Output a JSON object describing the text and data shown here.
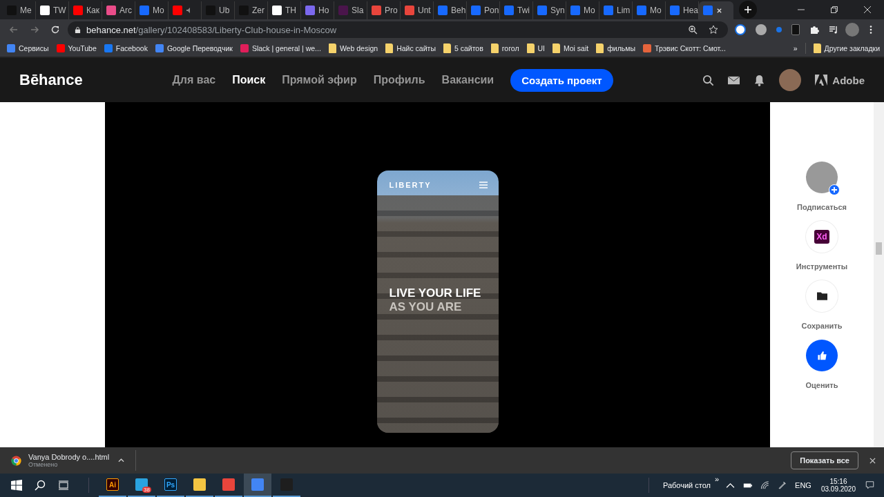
{
  "tabs": [
    {
      "title": "Me",
      "kind": "dark",
      "selected": false
    },
    {
      "title": "TW",
      "kind": "w",
      "selected": false
    },
    {
      "title": "Как",
      "kind": "yt",
      "selected": false
    },
    {
      "title": "Arc",
      "kind": "pink",
      "selected": false
    },
    {
      "title": "Mo",
      "kind": "be",
      "selected": false
    },
    {
      "kind": "yt",
      "muted": true,
      "selected": false
    },
    {
      "title": "Ub",
      "kind": "dark",
      "selected": false
    },
    {
      "title": "Zer",
      "kind": "dark",
      "selected": false
    },
    {
      "title": "TH",
      "kind": "m",
      "selected": false
    },
    {
      "title": "Ho",
      "kind": "violet",
      "selected": false
    },
    {
      "title": "Sla",
      "kind": "slack",
      "selected": false
    },
    {
      "title": "Pro",
      "kind": "red",
      "selected": false
    },
    {
      "title": "Unt",
      "kind": "red",
      "selected": false
    },
    {
      "title": "Beh",
      "kind": "be",
      "selected": false
    },
    {
      "title": "Pon",
      "kind": "be",
      "selected": false
    },
    {
      "title": "Twi",
      "kind": "be",
      "selected": false
    },
    {
      "title": "Syn",
      "kind": "be",
      "selected": false
    },
    {
      "title": "Mo",
      "kind": "be",
      "selected": false
    },
    {
      "title": "Lim",
      "kind": "be",
      "selected": false
    },
    {
      "title": "Mo",
      "kind": "be",
      "selected": false
    },
    {
      "title": "Hea",
      "kind": "be",
      "selected": false
    },
    {
      "kind": "be",
      "selected": true
    }
  ],
  "address": {
    "host": "behance.net",
    "path": "/gallery/102408583/Liberty-Club-house-in-Moscow"
  },
  "bookmarks": [
    {
      "label": "Сервисы",
      "kind": "apps"
    },
    {
      "label": "YouTube",
      "kind": "yt"
    },
    {
      "label": "Facebook",
      "kind": "fb"
    },
    {
      "label": "Google Переводчик",
      "kind": "translate"
    },
    {
      "label": "Slack | general | we...",
      "kind": "slack"
    },
    {
      "label": "Web design",
      "kind": "folder"
    },
    {
      "label": "Найс сайты",
      "kind": "folder"
    },
    {
      "label": "5 сайтов",
      "kind": "folder"
    },
    {
      "label": "гогол",
      "kind": "folder"
    },
    {
      "label": "UI",
      "kind": "folder"
    },
    {
      "label": "Moi sait",
      "kind": "folder"
    },
    {
      "label": "фильмы",
      "kind": "folder"
    },
    {
      "label": "Трэвис Скотт: Смот...",
      "kind": "f"
    }
  ],
  "bookmarks_more": "»",
  "other_bookmarks": "Другие закладки",
  "site": {
    "logo": "Bēhance",
    "nav": [
      {
        "label": "Для вас",
        "selected": false
      },
      {
        "label": "Поиск",
        "selected": true
      },
      {
        "label": "Прямой эфир",
        "selected": false
      },
      {
        "label": "Профиль",
        "selected": false
      },
      {
        "label": "Вакансии",
        "selected": false
      }
    ],
    "create_button": "Создать проект",
    "adobe": "Adobe"
  },
  "mockup": {
    "brand": "LIBERTY",
    "headline": "LIVE YOUR LIFE",
    "subline": "AS YOU ARE"
  },
  "actions": [
    {
      "kind": "follow",
      "label": "Подписаться"
    },
    {
      "kind": "tools",
      "label": "Инструменты",
      "badge": "Xd"
    },
    {
      "kind": "save",
      "label": "Сохранить"
    },
    {
      "kind": "like",
      "label": "Оценить"
    }
  ],
  "download": {
    "file": "Vanya Dobrody o....html",
    "status": "Отменено",
    "show_all": "Показать все"
  },
  "taskbar": {
    "apps": [
      {
        "kind": "ai",
        "label": "Ai",
        "active": false
      },
      {
        "kind": "telegram",
        "badge": "38",
        "active": false
      },
      {
        "kind": "ps",
        "label": "Ps",
        "active": false
      },
      {
        "kind": "explorer",
        "active": false
      },
      {
        "kind": "red",
        "active": false
      },
      {
        "kind": "chrome",
        "active": true
      },
      {
        "kind": "figma",
        "active": false
      }
    ],
    "desktop": "Рабочий стол",
    "chevrons": "»",
    "lang": "ENG",
    "time": "15:16",
    "date": "03.09.2020"
  }
}
